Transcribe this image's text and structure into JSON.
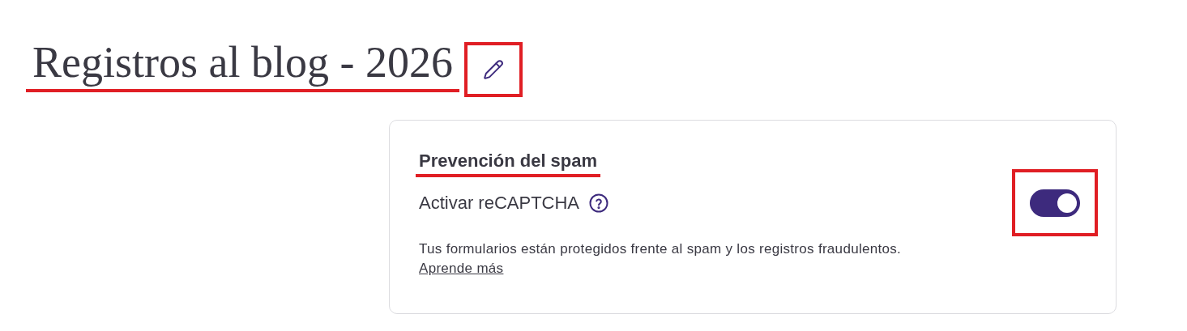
{
  "title": {
    "text": "Registros al blog - 2026",
    "underlined": true
  },
  "edit_button": {
    "highlighted": true
  },
  "card": {
    "heading": {
      "text": "Prevención del spam",
      "underlined": true
    },
    "setting": {
      "label": "Activar reCAPTCHA",
      "on": true,
      "highlighted": true
    },
    "description": "Tus formularios están protegidos frente al spam y los registros fraudulentos.",
    "link": "Aprende más"
  }
}
